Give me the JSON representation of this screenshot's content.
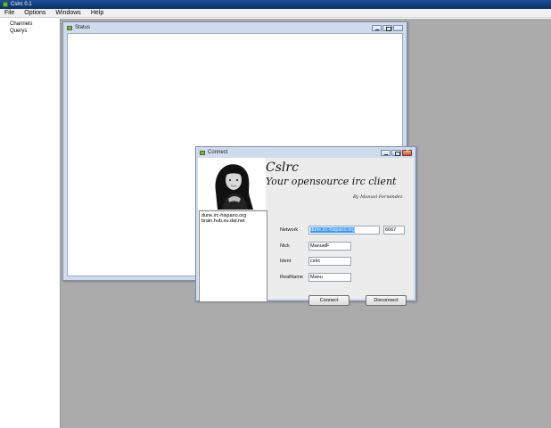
{
  "app": {
    "title": "Cslrc 0.1"
  },
  "menu": {
    "items": [
      "File",
      "Options",
      "Windows",
      "Help"
    ]
  },
  "tree": {
    "items": [
      "Channels",
      "Querys"
    ]
  },
  "status_window": {
    "title": "Status"
  },
  "connect_window": {
    "title": "Connect",
    "heading_title": "Cslrc",
    "heading_subtitle": "Your opensource irc client",
    "byline": "By Manuel Fernández",
    "servers": [
      "dune.irc-hispano.org",
      "brain.hub.eu.dal.net"
    ],
    "labels": {
      "network": "Network",
      "nick": "Nick",
      "ident": "Ident",
      "realname": "RealName"
    },
    "values": {
      "network": "dune.irc-hispano.org",
      "port": "6667",
      "nick": "ManuelF",
      "ident": "cslrc",
      "realname": "Manu"
    },
    "buttons": {
      "connect": "Connect",
      "disconnect": "Disconnect"
    }
  }
}
